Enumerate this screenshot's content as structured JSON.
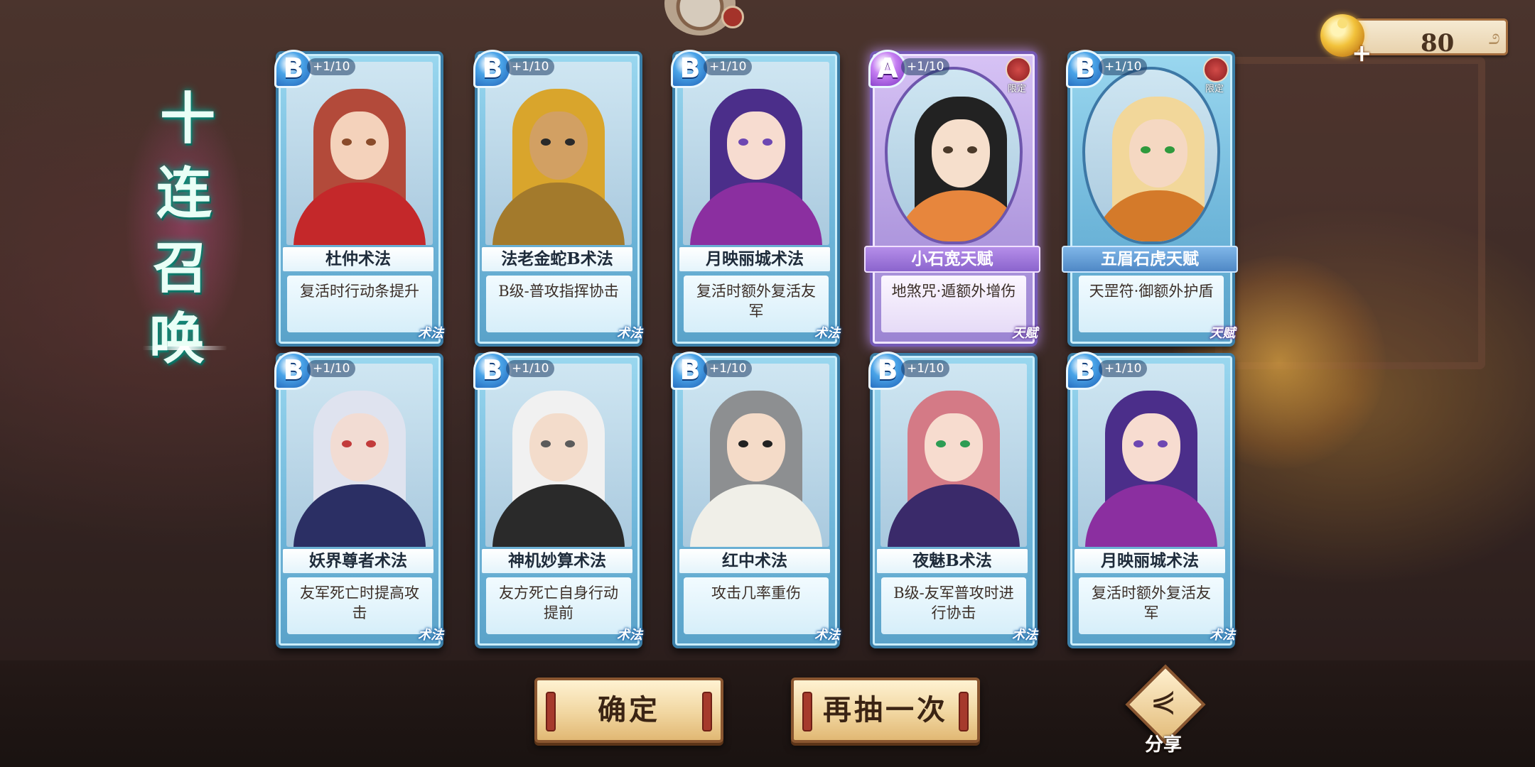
{
  "title": [
    "十",
    "连",
    "召",
    "唤"
  ],
  "currency": {
    "value": "80",
    "swirl": "೨",
    "plus": "+"
  },
  "buttons": {
    "confirm": "确定",
    "redraw": "再抽一次",
    "share": "分享"
  },
  "share_icon_glyph": "⋞",
  "cards": [
    {
      "rank": "B",
      "count": "+1/10",
      "name": "杜仲术法",
      "desc": "复活时行动条提升",
      "type": "术法",
      "limited": false
    },
    {
      "rank": "B",
      "count": "+1/10",
      "name": "法老金蛇B术法",
      "desc": "B级-普攻指挥协击",
      "type": "术法",
      "limited": false
    },
    {
      "rank": "B",
      "count": "+1/10",
      "name": "月映丽城术法",
      "desc": "复活时额外复活友军",
      "type": "术法",
      "limited": false
    },
    {
      "rank": "A",
      "count": "+1/10",
      "name": "小石宽天赋",
      "desc": "地煞咒·遁额外增伤",
      "type": "天赋",
      "limited": true,
      "limited_label": "限定"
    },
    {
      "rank": "B",
      "count": "+1/10",
      "name": "五眉石虎天赋",
      "desc": "天罡符·御额外护盾",
      "type": "天赋",
      "limited": true,
      "limited_label": "限定"
    },
    {
      "rank": "B",
      "count": "+1/10",
      "name": "妖界尊者术法",
      "desc": "友军死亡时提高攻击",
      "type": "术法",
      "limited": false
    },
    {
      "rank": "B",
      "count": "+1/10",
      "name": "神机妙算术法",
      "desc": "友方死亡自身行动提前",
      "type": "术法",
      "limited": false
    },
    {
      "rank": "B",
      "count": "+1/10",
      "name": "红中术法",
      "desc": "攻击几率重伤",
      "type": "术法",
      "limited": false
    },
    {
      "rank": "B",
      "count": "+1/10",
      "name": "夜魅B术法",
      "desc": "B级-友军普攻时进行协击",
      "type": "术法",
      "limited": false
    },
    {
      "rank": "B",
      "count": "+1/10",
      "name": "月映丽城术法",
      "desc": "复活时额外复活友军",
      "type": "术法",
      "limited": false
    }
  ],
  "palette": {
    "card_B": "#6db5d9",
    "card_A": "#b19adf",
    "accent_gold": "#f1d6a0",
    "title_glow": "#14a18c"
  }
}
